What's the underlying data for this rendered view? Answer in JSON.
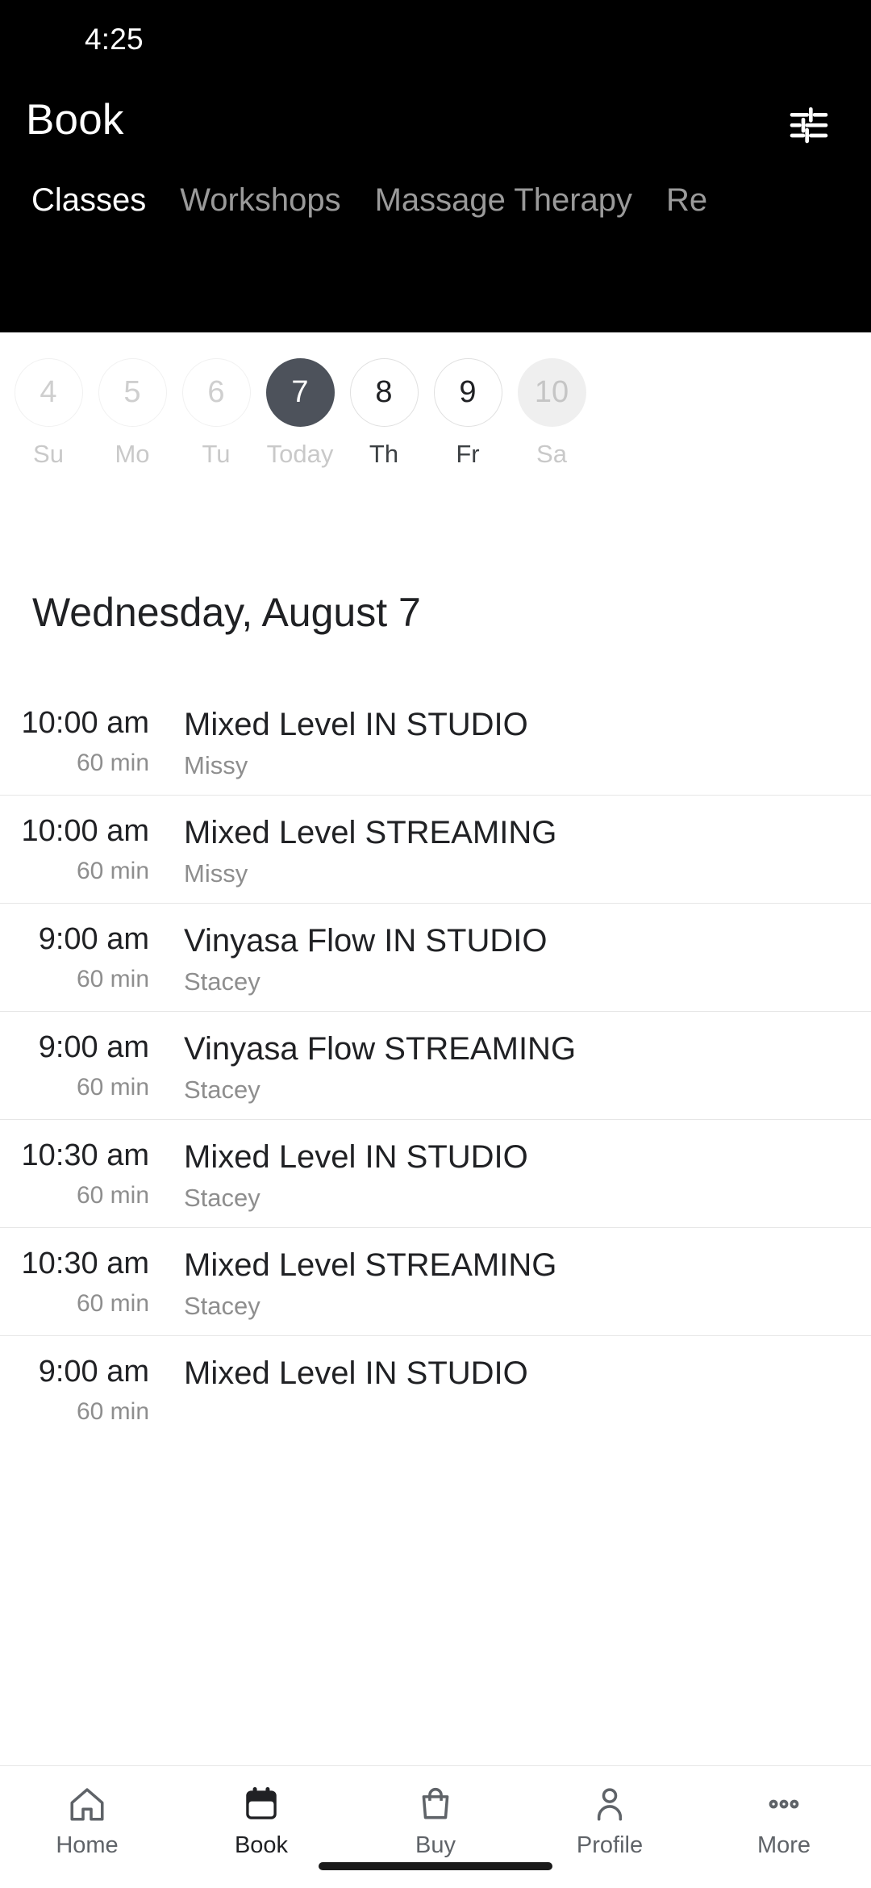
{
  "status_bar": {
    "time": "4:25"
  },
  "app_bar": {
    "title": "Book",
    "filter_icon": "tune-filter-icon"
  },
  "tabs": [
    {
      "label": "Classes",
      "active": true
    },
    {
      "label": "Workshops",
      "active": false
    },
    {
      "label": "Massage Therapy",
      "active": false
    },
    {
      "label": "Re",
      "active": false
    }
  ],
  "date_strip": {
    "days": [
      {
        "num": "4",
        "label": "Su",
        "state": "past"
      },
      {
        "num": "5",
        "label": "Mo",
        "state": "past"
      },
      {
        "num": "6",
        "label": "Tu",
        "state": "past"
      },
      {
        "num": "7",
        "label": "Today",
        "state": "selected"
      },
      {
        "num": "8",
        "label": "Th",
        "state": "default"
      },
      {
        "num": "9",
        "label": "Fr",
        "state": "default"
      },
      {
        "num": "10",
        "label": "Sa",
        "state": "muted"
      }
    ]
  },
  "date_heading": "Wednesday, August 7",
  "classes": [
    {
      "time": "10:00 am",
      "duration": "60 min",
      "title": "Mixed Level IN STUDIO",
      "instructor": "Missy"
    },
    {
      "time": "10:00 am",
      "duration": "60 min",
      "title": "Mixed Level STREAMING",
      "instructor": "Missy"
    },
    {
      "time": "9:00 am",
      "duration": "60 min",
      "title": "Vinyasa Flow IN STUDIO",
      "instructor": "Stacey"
    },
    {
      "time": "9:00 am",
      "duration": "60 min",
      "title": "Vinyasa Flow STREAMING",
      "instructor": "Stacey"
    },
    {
      "time": "10:30 am",
      "duration": "60 min",
      "title": "Mixed Level IN STUDIO",
      "instructor": "Stacey"
    },
    {
      "time": "10:30 am",
      "duration": "60 min",
      "title": "Mixed Level STREAMING",
      "instructor": "Stacey"
    },
    {
      "time": "9:00 am",
      "duration": "60 min",
      "title": "Mixed Level IN STUDIO",
      "instructor": ""
    }
  ],
  "bottom_nav": [
    {
      "label": "Home",
      "icon": "home-icon",
      "active": false
    },
    {
      "label": "Book",
      "icon": "calendar-icon",
      "active": true
    },
    {
      "label": "Buy",
      "icon": "bag-icon",
      "active": false
    },
    {
      "label": "Profile",
      "icon": "person-icon",
      "active": false
    },
    {
      "label": "More",
      "icon": "dots-icon",
      "active": false
    }
  ],
  "colors": {
    "header_bg": "#000000",
    "selected_day": "#4d525b",
    "tab_active": "#ffffff",
    "tab_inactive": "#9a9a9a",
    "text_primary": "#202124",
    "text_secondary": "#8e8e8e",
    "divider": "#e6e6e6"
  }
}
